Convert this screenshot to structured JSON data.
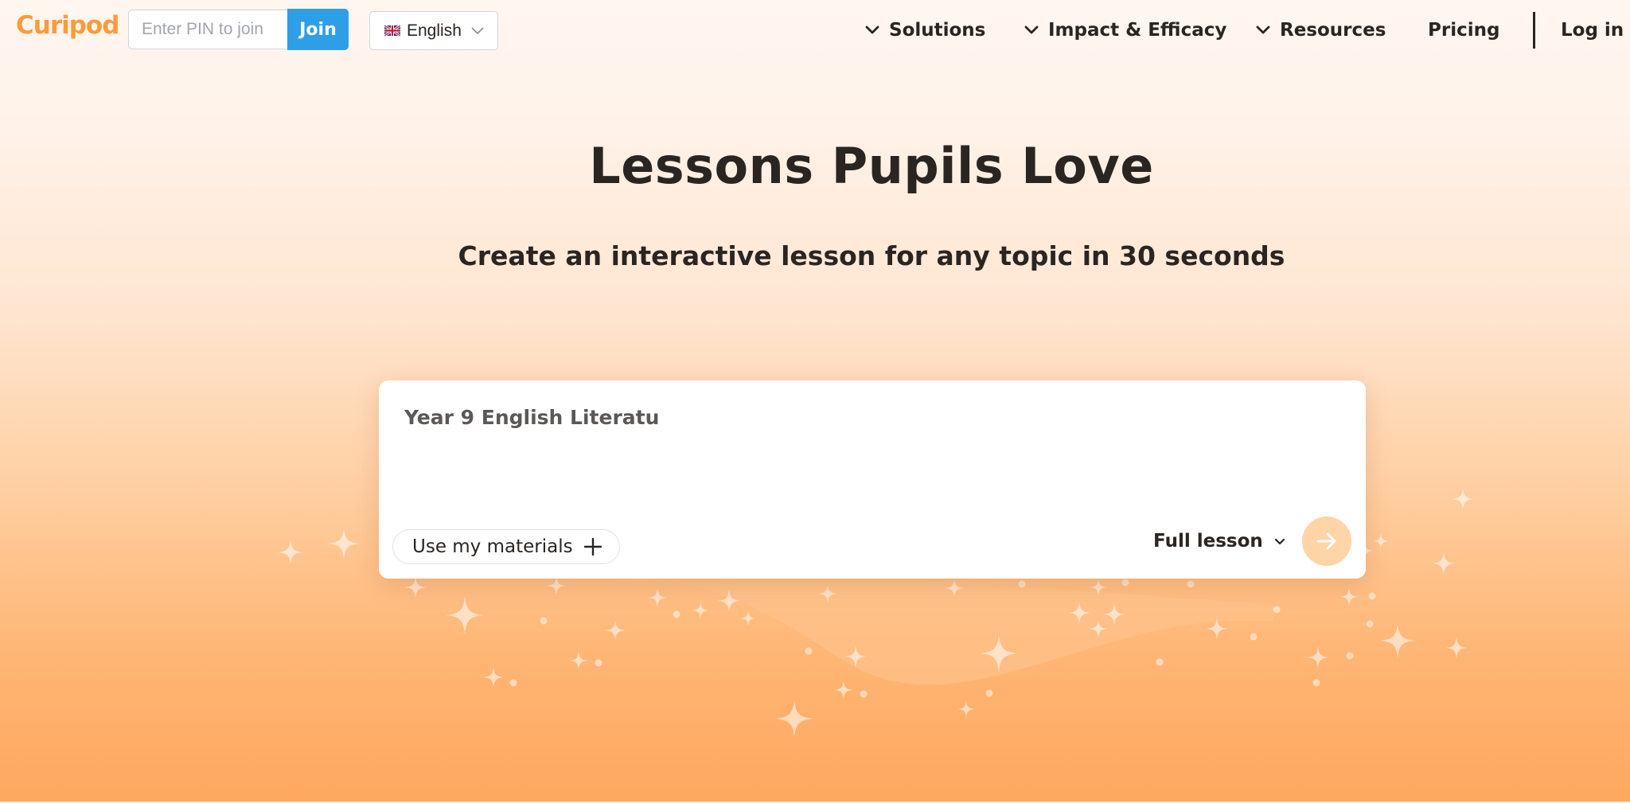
{
  "brand": {
    "logo_text": "Curipod",
    "accent_color": "#ff9a3c",
    "join_color": "#2e9fe6"
  },
  "header": {
    "pin_placeholder": "Enter PIN to join",
    "join_label": "Join",
    "language": {
      "flag_icon": "uk-flag-icon",
      "selected": "English"
    },
    "nav": [
      {
        "label": "Solutions",
        "has_dropdown": true
      },
      {
        "label": "Impact & Efficacy",
        "has_dropdown": true
      },
      {
        "label": "Resources",
        "has_dropdown": true
      },
      {
        "label": "Pricing",
        "has_dropdown": false
      }
    ],
    "login_label": "Log in"
  },
  "hero": {
    "title": "Lessons Pupils Love",
    "subtitle": "Create an interactive lesson for any topic in 30 seconds"
  },
  "prompt": {
    "value": "Year 9 English Literatu",
    "materials_label": "Use my materials",
    "materials_icon": "plus-icon",
    "lesson_type": "Full lesson",
    "lesson_type_icon": "chevron-down-icon",
    "submit_icon": "arrow-right-icon"
  }
}
